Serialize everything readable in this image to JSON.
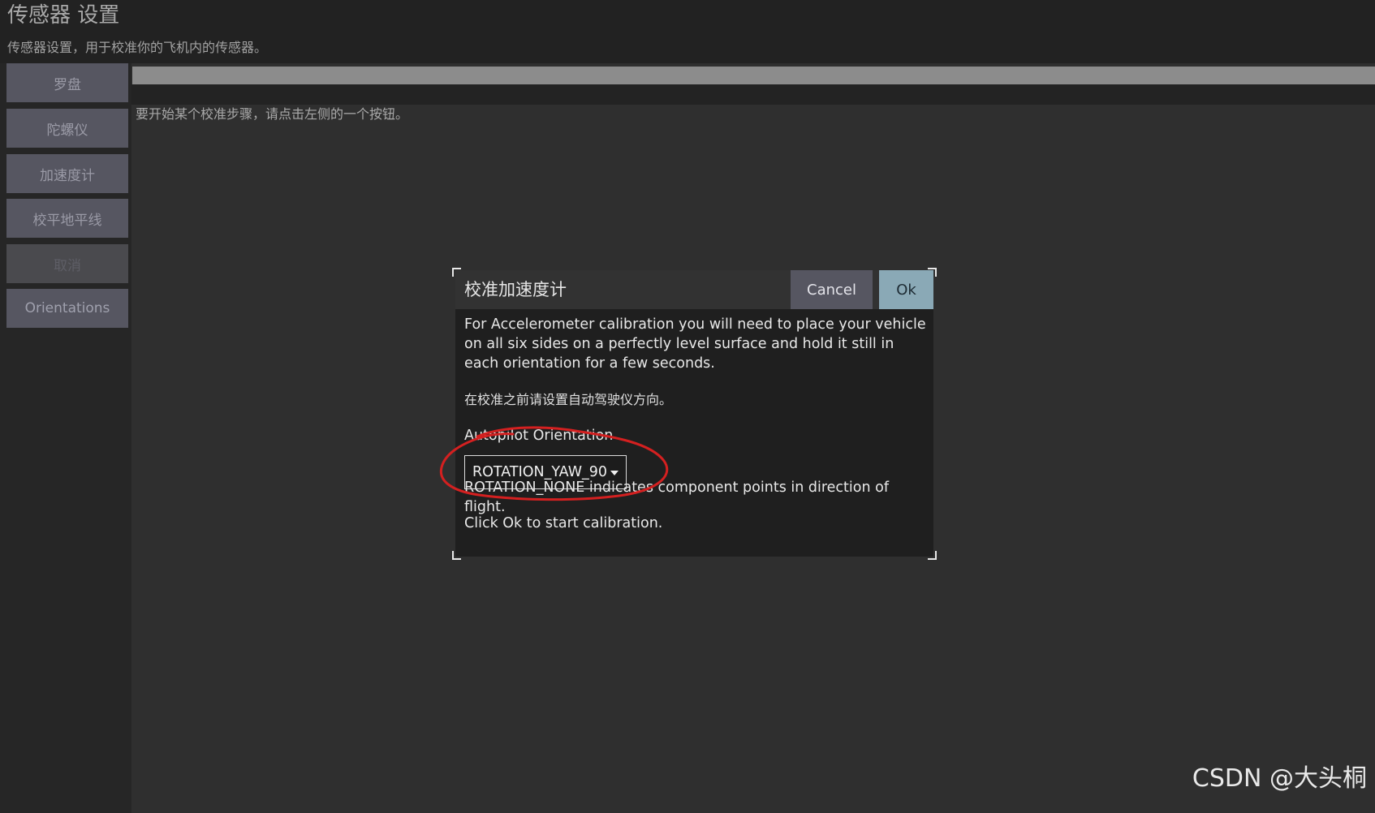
{
  "page": {
    "title": "传感器 设置",
    "subtitle": "传感器设置，用于校准你的飞机内的传感器。"
  },
  "sidebar": {
    "items": [
      {
        "label": "罗盘",
        "enabled": true
      },
      {
        "label": "陀螺仪",
        "enabled": true
      },
      {
        "label": "加速度计",
        "enabled": true
      },
      {
        "label": "校平地平线",
        "enabled": true
      },
      {
        "label": "取消",
        "enabled": false
      },
      {
        "label": "Orientations",
        "enabled": true
      }
    ]
  },
  "main": {
    "hint": "要开始某个校准步骤，请点击左侧的一个按钮。",
    "progress": 0
  },
  "dialog": {
    "title": "校准加速度计",
    "cancel_label": "Cancel",
    "ok_label": "Ok",
    "description": "For Accelerometer calibration you will need to place your vehicle on all six sides on a perfectly level surface and hold it still in each orientation for a few seconds.",
    "orientation_prompt": "在校准之前请设置自动驾驶仪方向。",
    "orientation_label": "Autopilot Orientation",
    "orientation_value": "ROTATION_YAW_90",
    "orientation_help": "ROTATION_NONE indicates component points in direction of flight.",
    "start_hint": "Click Ok to start calibration."
  },
  "watermark": "CSDN @大头桐",
  "colors": {
    "background": "#222222",
    "panel": "#2f2f2f",
    "button": "#565661",
    "ok_button": "#8aa9b6",
    "annotation": "#d42020"
  }
}
